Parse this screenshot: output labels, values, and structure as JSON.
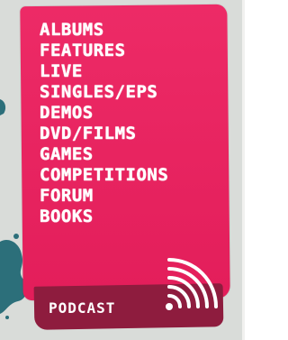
{
  "menu": {
    "items": [
      {
        "label": "ALBUMS"
      },
      {
        "label": "FEATURES"
      },
      {
        "label": "LIVE"
      },
      {
        "label": "SINGLES/EPS"
      },
      {
        "label": "DEMOS"
      },
      {
        "label": "DVD/FILMS"
      },
      {
        "label": "GAMES"
      },
      {
        "label": "COMPETITIONS"
      },
      {
        "label": "FORUM"
      },
      {
        "label": "BOOKS"
      }
    ]
  },
  "podcast": {
    "label": "PODCAST",
    "icon": "broadcast-signal-icon"
  },
  "colors": {
    "card": "#ec1f5e",
    "tab": "#8e1c3e",
    "splatter": "#2c6f7a",
    "background": "#d9dcd9",
    "text": "#ffffff"
  }
}
